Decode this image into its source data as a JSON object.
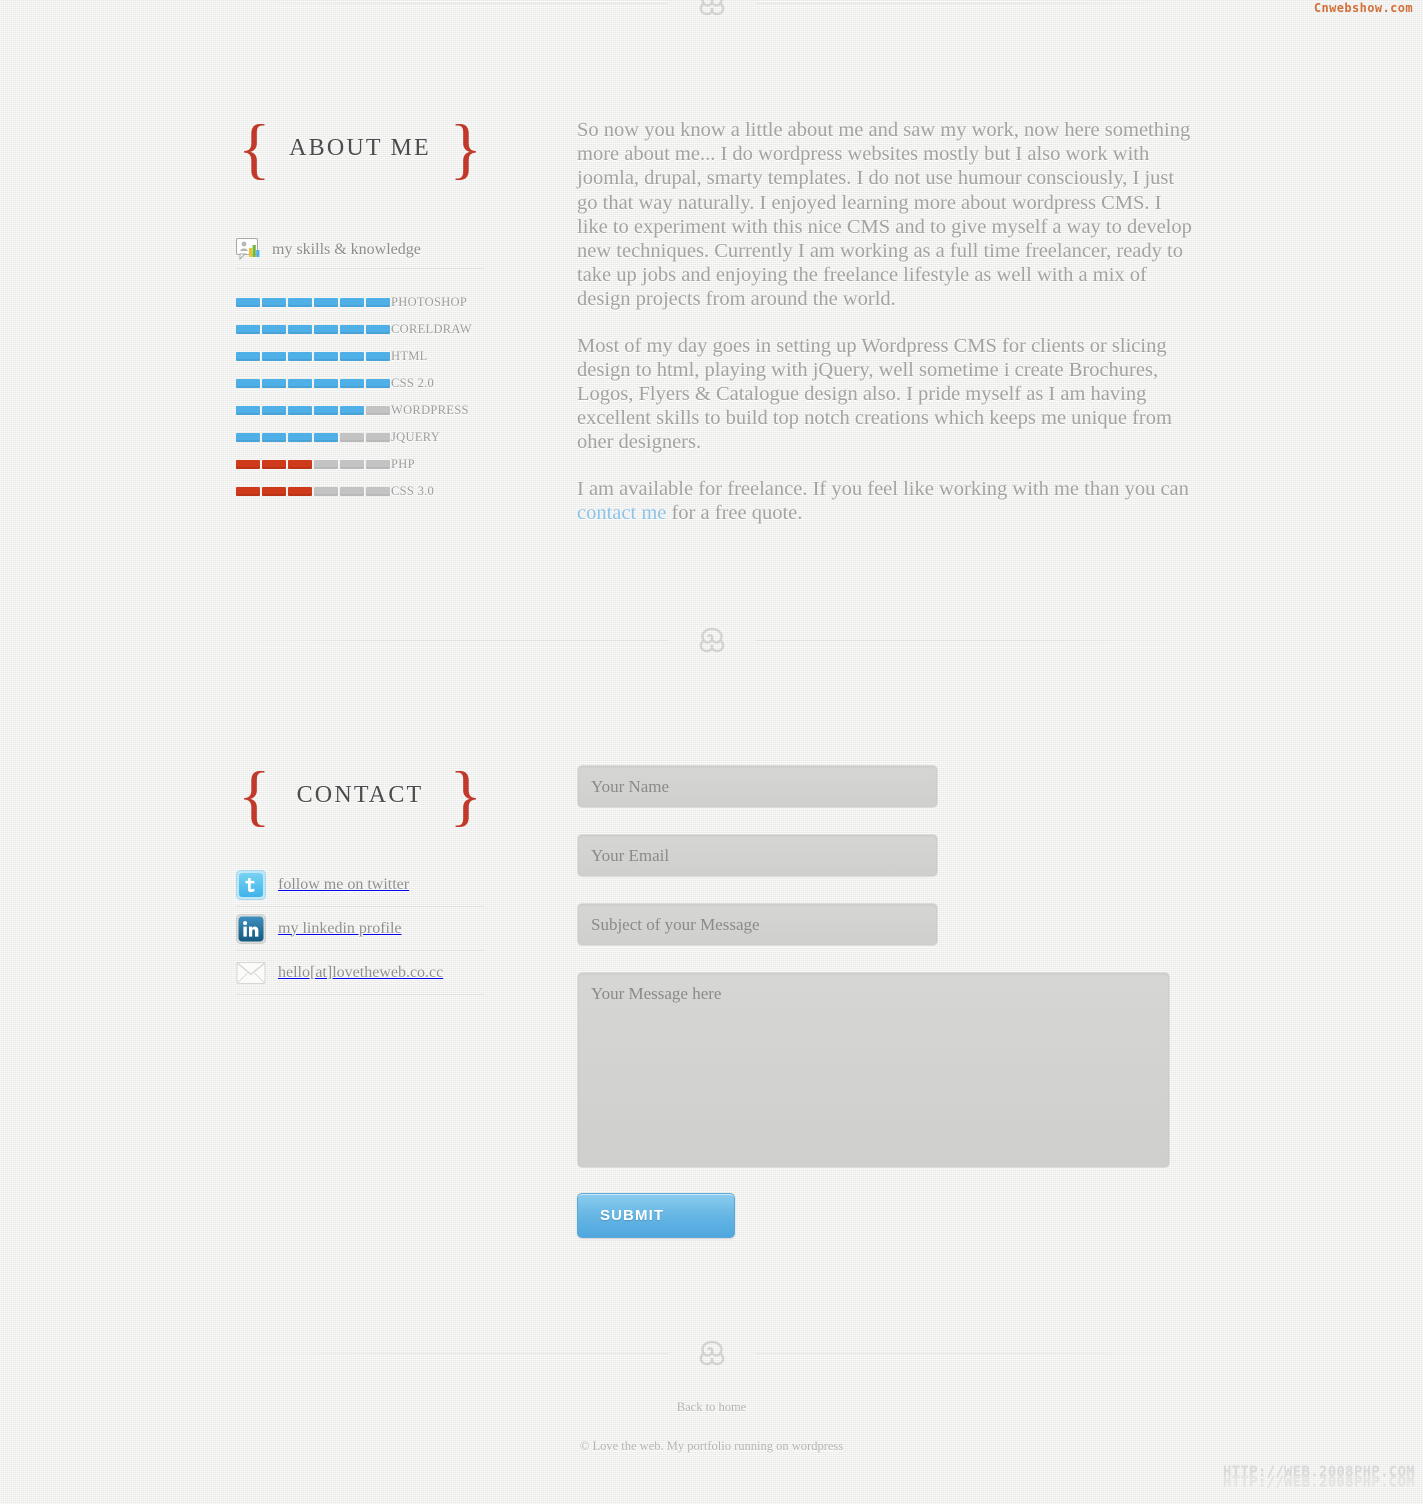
{
  "watermarks": {
    "top_right": "Cnwebshow.com",
    "bottom_right": "HTTP://WEB.2008PHP.COM",
    "accent_orange": "#d2703a"
  },
  "colors": {
    "brace_red": "#c0392b",
    "bar_blue": "#4fb0e8",
    "bar_red": "#cf3a1b",
    "bar_empty": "#c3c3c3",
    "link_blue": "#8cc3e8",
    "submit_blue": "#65b5e4",
    "page_bg": "#eeeeec",
    "body_text": "#a3a3a2"
  },
  "about": {
    "heading": "ABOUT ME",
    "brace_left": "{",
    "brace_right": "}",
    "skills_label": "my skills & knowledge",
    "skills_icon": "skills-chart-icon",
    "paragraphs": [
      "So now you know a little about me and saw my work, now here something more about me... I do wordpress websites mostly but I also work with joomla, drupal, smarty templates. I do not use humour consciously, I just go that way naturally. I enjoyed learning more about wordpress CMS. I like to experiment with this nice CMS and to give myself a way to develop new techniques. Currently I am working as a full time freelancer, ready to take up jobs and enjoying the freelance lifestyle as well with a mix of design projects from around the world.",
      "Most of my day goes in setting up Wordpress CMS for clients or slicing design to html, playing with jQuery, well sometime i create Brochures, Logos, Flyers & Catalogue design also. I pride myself as I am having excellent skills to build top notch creations which keeps me unique from oher designers."
    ],
    "availability": {
      "before": "I am available for freelance. If you feel like working with me than you can ",
      "link_text": "contact me",
      "after": " for a free quote."
    }
  },
  "chart_data": {
    "type": "bar",
    "title": "my skills & knowledge",
    "xlabel": "",
    "ylabel": "",
    "segments_total": 6,
    "categories": [
      "PHOTOSHOP",
      "CORELDRAW",
      "HTML",
      "CSS 2.0",
      "WORDPRESS",
      "JQUERY",
      "PHP",
      "CSS 3.0"
    ],
    "values": [
      6,
      6,
      6,
      6,
      5,
      4,
      3,
      3
    ],
    "series": [
      {
        "name": "skill level (segments filled of 6)",
        "values": [
          6,
          6,
          6,
          6,
          5,
          4,
          3,
          3
        ]
      }
    ],
    "bar_colors": [
      "#4fb0e8",
      "#4fb0e8",
      "#4fb0e8",
      "#4fb0e8",
      "#4fb0e8",
      "#4fb0e8",
      "#cf3a1b",
      "#cf3a1b"
    ],
    "empty_color": "#c3c3c3",
    "ylim": [
      0,
      6
    ],
    "grid": false,
    "legend": "none",
    "orientation": "horizontal"
  },
  "skills": [
    {
      "name": "PHOTOSHOP",
      "filled": 6,
      "total": 6,
      "color": "blue"
    },
    {
      "name": "CORELDRAW",
      "filled": 6,
      "total": 6,
      "color": "blue"
    },
    {
      "name": "HTML",
      "filled": 6,
      "total": 6,
      "color": "blue"
    },
    {
      "name": "CSS 2.0",
      "filled": 6,
      "total": 6,
      "color": "blue"
    },
    {
      "name": "WORDPRESS",
      "filled": 5,
      "total": 6,
      "color": "blue"
    },
    {
      "name": "JQUERY",
      "filled": 4,
      "total": 6,
      "color": "blue"
    },
    {
      "name": "PHP",
      "filled": 3,
      "total": 6,
      "color": "red"
    },
    {
      "name": "CSS 3.0",
      "filled": 3,
      "total": 6,
      "color": "red"
    }
  ],
  "contact": {
    "heading": "CONTACT",
    "brace_left": "{",
    "brace_right": "}",
    "links": [
      {
        "icon": "twitter-icon",
        "label": "follow me on twitter"
      },
      {
        "icon": "linkedin-icon",
        "label": "my linkedin profile"
      },
      {
        "icon": "email-envelope-icon",
        "label": "hello[at]lovetheweb.co.cc"
      }
    ],
    "form": {
      "name_placeholder": "Your Name",
      "name_value": "",
      "email_placeholder": "Your Email",
      "email_value": "",
      "subject_placeholder": "Subject of your Message",
      "subject_value": "",
      "message_placeholder": "Your Message here",
      "message_value": "",
      "submit_label": "SUBMIT"
    }
  },
  "footer": {
    "back_link": "Back to home",
    "copyright": "© Love the web. My portfolio running on wordpress"
  }
}
